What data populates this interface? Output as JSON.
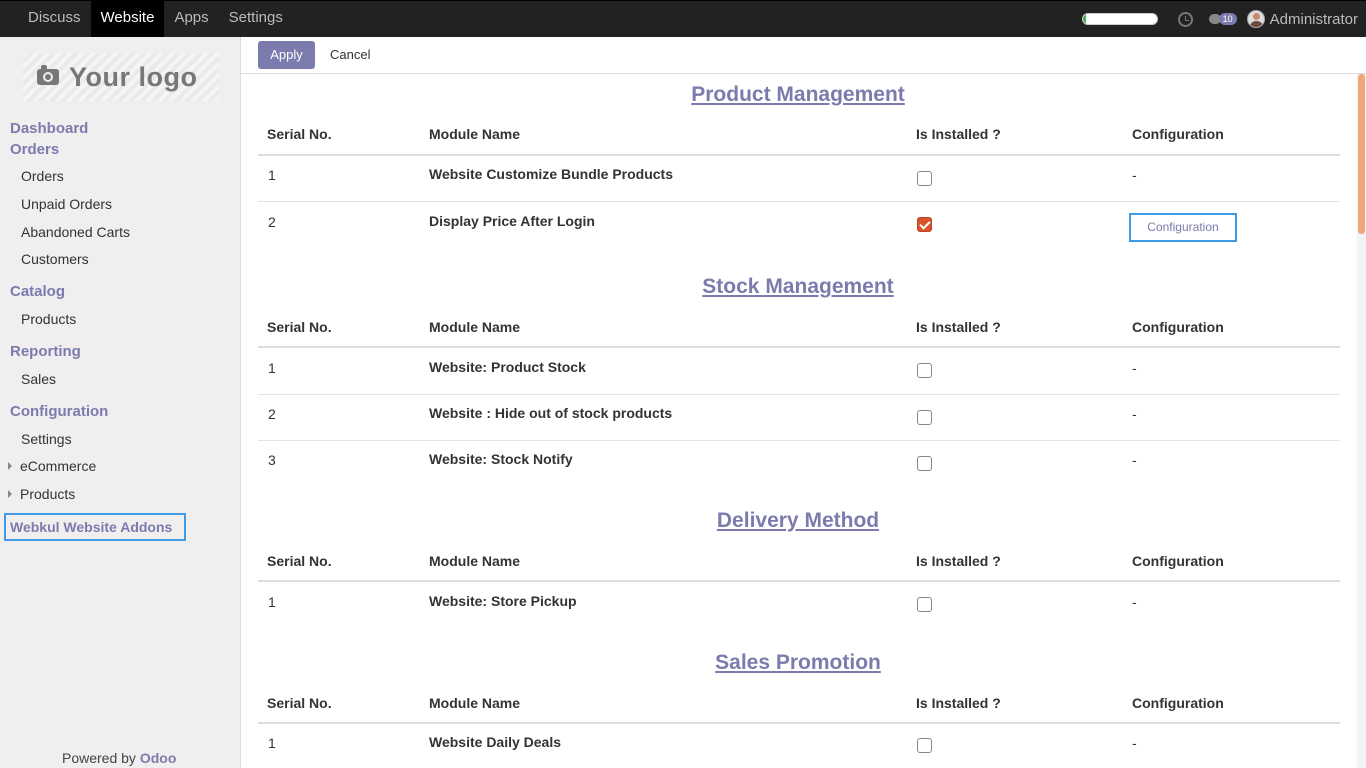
{
  "topbar": {
    "menu": [
      "Discuss",
      "Website",
      "Apps",
      "Settings"
    ],
    "active": "Website",
    "progress": 0.05,
    "progress_color": "#4caf50",
    "messages_count": "10",
    "user_name": "Administrator"
  },
  "sidebar": {
    "logo_text": "Your logo",
    "dashboard": "Dashboard",
    "orders": "Orders",
    "orders_items": [
      "Orders",
      "Unpaid Orders",
      "Abandoned Carts",
      "Customers"
    ],
    "catalog": "Catalog",
    "catalog_items": [
      "Products"
    ],
    "reporting": "Reporting",
    "reporting_items": [
      "Sales"
    ],
    "configuration": "Configuration",
    "configuration_items": [
      "Settings",
      "eCommerce",
      "Products"
    ],
    "addons": "Webkul Website Addons",
    "powered_by": "Powered by",
    "powered_brand": "Odoo"
  },
  "actions": {
    "apply": "Apply",
    "cancel": "Cancel"
  },
  "columns": {
    "serial": "Serial No.",
    "module": "Module Name",
    "installed": "Is Installed ?",
    "config": "Configuration"
  },
  "sections": [
    {
      "title": "Product Management",
      "rows": [
        {
          "serial": "1",
          "name": "Website Customize Bundle Products",
          "installed": false,
          "config": "-"
        },
        {
          "serial": "2",
          "name": "Display Price After Login",
          "installed": true,
          "config": "Configuration"
        }
      ]
    },
    {
      "title": "Stock Management",
      "rows": [
        {
          "serial": "1",
          "name": "Website: Product Stock",
          "installed": false,
          "config": "-"
        },
        {
          "serial": "2",
          "name": "Website : Hide out of stock products",
          "installed": false,
          "config": "-"
        },
        {
          "serial": "3",
          "name": "Website: Stock Notify",
          "installed": false,
          "config": "-"
        }
      ]
    },
    {
      "title": "Delivery Method",
      "rows": [
        {
          "serial": "1",
          "name": "Website: Store Pickup",
          "installed": false,
          "config": "-"
        }
      ]
    },
    {
      "title": "Sales Promotion",
      "rows": [
        {
          "serial": "1",
          "name": "Website Daily Deals",
          "installed": false,
          "config": "-"
        }
      ]
    }
  ],
  "colors": {
    "accent": "#7c7bad",
    "highlight": "#3d9be9",
    "checked": "#d9542b"
  }
}
